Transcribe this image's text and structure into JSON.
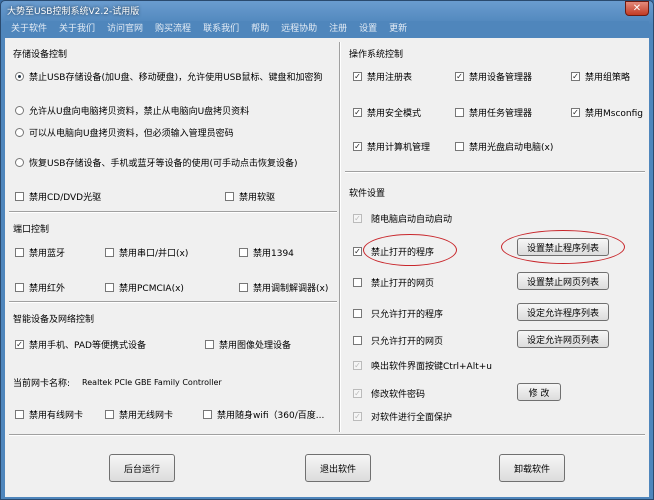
{
  "window": {
    "title": "大势至USB控制系统V2.2-试用版",
    "close_glyph": "✕"
  },
  "menu": [
    "关于软件",
    "关于我们",
    "访问官网",
    "购买流程",
    "联系我们",
    "帮助",
    "远程协助",
    "注册",
    "设置",
    "更新"
  ],
  "storage": {
    "heading": "存储设备控制",
    "radios": [
      {
        "label": "禁止USB存储设备(加U盘、移动硬盘)，允许使用USB鼠标、键盘和加密狗",
        "selected": true
      },
      {
        "label": "允许从U盘向电脑拷贝资料，禁止从电脑向U盘拷贝资料",
        "selected": false
      },
      {
        "label": "可以从电脑向U盘拷贝资料，但必须输入管理员密码",
        "selected": false
      },
      {
        "label": "恢复USB存储设备、手机或蓝牙等设备的使用(可手动点击恢复设备)",
        "selected": false
      }
    ],
    "disable_cd": "禁用CD/DVD光驱",
    "disable_floppy": "禁用软驱"
  },
  "ports": {
    "heading": "端口控制",
    "bluetooth": "禁用蓝牙",
    "serial": "禁用串口/并口(x)",
    "ieee1394": "禁用1394",
    "infrared": "禁用红外",
    "pcmcia": "禁用PCMCIA(x)",
    "modem": "禁用调制解调器(x)"
  },
  "smart": {
    "heading": "智能设备及网络控制",
    "phone": "禁用手机、PAD等便携式设备",
    "imaging": "禁用图像处理设备",
    "nic_label": "当前网卡名称:",
    "nic_value": "Realtek PCIe GBE Family Controller",
    "wired": "禁用有线网卡",
    "wireless": "禁用无线网卡",
    "wifi": "禁用随身wifi（360/百度..."
  },
  "os": {
    "heading": "操作系统控制",
    "registry": "禁用注册表",
    "device_manager": "禁用设备管理器",
    "group_policy": "禁用组策略",
    "safe_mode": "禁用安全模式",
    "task_manager": "禁用任务管理器",
    "msconfig": "禁用Msconfig",
    "computer_mgmt": "禁用计算机管理",
    "cd_boot": "禁用光盘启动电脑(x)"
  },
  "software": {
    "heading": "软件设置",
    "autostart": "随电脑启动自动启动",
    "block_programs": "禁止打开的程序",
    "block_programs_btn": "设置禁止程序列表",
    "block_sites": "禁止打开的网页",
    "block_sites_btn": "设置禁止网页列表",
    "allow_programs": "只允许打开的程序",
    "allow_programs_btn": "设定允许程序列表",
    "allow_sites": "只允许打开的网页",
    "allow_sites_btn": "设定允许网页列表",
    "hotkey": "唤出软件界面按键Ctrl+Alt+u",
    "change_password": "修改软件密码",
    "change_password_btn": "修 改",
    "self_protect": "对软件进行全面保护"
  },
  "bottom": {
    "background_run": "后台运行",
    "exit": "退出软件",
    "uninstall": "卸载软件"
  },
  "check": "✓",
  "colors": {
    "annotation": "#c8262b",
    "titlebar": "#4f86bc"
  }
}
